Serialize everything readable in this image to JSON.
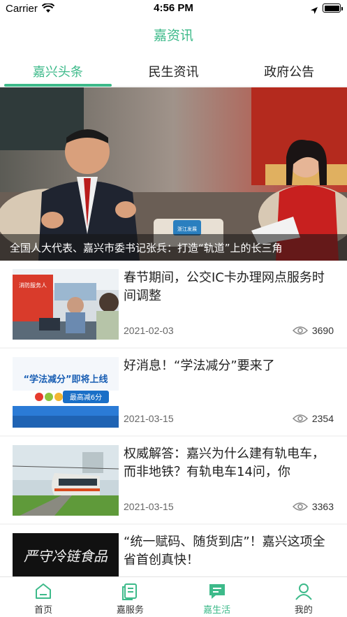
{
  "status_bar": {
    "carrier": "Carrier",
    "time": "4:56 PM"
  },
  "nav": {
    "title": "嘉资讯"
  },
  "tabs": [
    {
      "label": "嘉兴头条",
      "active": true
    },
    {
      "label": "民生资讯",
      "active": false
    },
    {
      "label": "政府公告",
      "active": false
    }
  ],
  "hero": {
    "caption": "全国人大代表、嘉兴市委书记张兵：打造“轨道”上的长三角",
    "studio_logo": "浙江发展"
  },
  "news": [
    {
      "title": "春节期间，公交IC卡办理网点服务时间调整",
      "date": "2021-02-03",
      "views": "3690",
      "thumb_text": "消防服务人"
    },
    {
      "title": "好消息！“学法减分”要来了",
      "date": "2021-03-15",
      "views": "2354",
      "thumb_text": "“学法减分”即将上线",
      "thumb_badge": "最高减6分"
    },
    {
      "title": "权威解答：嘉兴为什么建有轨电车，而非地铁？有轨电车14问，你",
      "date": "2021-03-15",
      "views": "3363"
    },
    {
      "title": "“统一赋码、随货到店”！嘉兴这项全省首创真快！",
      "thumb_text": "严守冷链食品"
    }
  ],
  "tab_bar": [
    {
      "label": "首页",
      "icon": "home-icon",
      "active": false
    },
    {
      "label": "嘉服务",
      "icon": "service-icon",
      "active": false
    },
    {
      "label": "嘉生活",
      "icon": "chat-icon",
      "active": true
    },
    {
      "label": "我的",
      "icon": "person-icon",
      "active": false
    }
  ],
  "colors": {
    "accent": "#3dba8a",
    "text": "#222222",
    "muted": "#666666"
  }
}
